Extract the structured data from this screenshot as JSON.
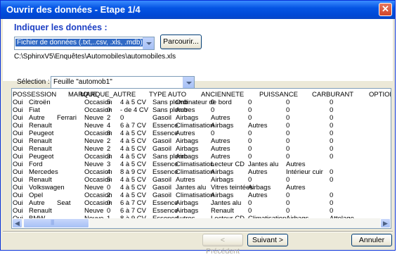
{
  "window": {
    "title": "Ouvrir des données - Etape 1/4",
    "close": "✕"
  },
  "heading": "Indiquer les données :",
  "file_type": {
    "selected": "Fichier de données (.txt,..csv, .xls, .mdb)"
  },
  "browse_label": "Parcourir...",
  "file_path": "C:\\SphinxV5\\Enquêtes\\Automobiles\\automobiles.xls",
  "selection": {
    "label": "Sélection :",
    "value": "Feuille \"automob1\""
  },
  "table": {
    "headers": [
      "POSSESSION",
      "MARQUE",
      "MARQUE_AUTRE",
      "TYPE AUTO",
      "ANCIENNETE",
      "PUISSANCE",
      "CARBURANT",
      "OPTIONS"
    ],
    "rows": [
      [
        "Oui",
        "Citroën",
        "",
        "Occasion",
        "5",
        "4 à 5 CV",
        "Sans plomb",
        "Ordinateur de bord",
        "0",
        "0",
        "0",
        "0"
      ],
      [
        "Oui",
        "Fiat",
        "",
        "Occasion",
        "0",
        "- de 4 CV",
        "Sans plomb",
        "Autres",
        "0",
        "0",
        "0",
        "0"
      ],
      [
        "Oui",
        "Autre",
        "Ferrari",
        "Neuve",
        "2",
        "0",
        "Gasoil",
        "Airbags",
        "Autres",
        "0",
        "0",
        "0"
      ],
      [
        "Oui",
        "Renault",
        "",
        "Neuve",
        "4",
        "6 à 7 CV",
        "Essence",
        "Climatisation",
        "Airbags",
        "Autres",
        "0",
        "0"
      ],
      [
        "Oui",
        "Peugeot",
        "",
        "Occasion",
        "8",
        "4 à 5 CV",
        "Essence",
        "Autres",
        "0",
        "0",
        "0",
        "0"
      ],
      [
        "Oui",
        "Renault",
        "",
        "Neuve",
        "2",
        "4 à 5 CV",
        "Gasoil",
        "Airbags",
        "Autres",
        "0",
        "0",
        "0"
      ],
      [
        "Oui",
        "Renault",
        "",
        "Neuve",
        "2",
        "4 à 5 CV",
        "Gasoil",
        "Airbags",
        "Autres",
        "0",
        "0",
        "0"
      ],
      [
        "Oui",
        "Peugeot",
        "",
        "Occasion",
        "3",
        "4 à 5 CV",
        "Sans plomb",
        "Airbags",
        "Autres",
        "0",
        "0",
        "0"
      ],
      [
        "Oui",
        "Ford",
        "",
        "Neuve",
        "3",
        "4 à 5 CV",
        "Essence",
        "Climatisation",
        "Lecteur CD",
        "Jantes alu",
        "Autres",
        ""
      ],
      [
        "Oui",
        "Mercedes",
        "",
        "Occasion",
        "4",
        "8 à 9 CV",
        "Essence",
        "Climatisation",
        "Airbags",
        "Autres",
        "Intérieur cuir",
        "0"
      ],
      [
        "Oui",
        "Renault",
        "",
        "Occasion",
        "5",
        "4 à 5 CV",
        "Gasoil",
        "Autres",
        "Airbags",
        "0",
        "0",
        "0"
      ],
      [
        "Oui",
        "Volkswagen",
        "",
        "Neuve",
        "0",
        "4 à 5 CV",
        "Gasoil",
        "Jantes alu",
        "Vitres teintées",
        "Airbags",
        "Autres",
        ""
      ],
      [
        "Oui",
        "Opel",
        "",
        "Occasion",
        "2",
        "4 à 5 CV",
        "Gasoil",
        "Climatisation",
        "Airbags",
        "Autres",
        "0",
        "0"
      ],
      [
        "Oui",
        "Autre",
        "Seat",
        "Occasion",
        "0",
        "6 à 7 CV",
        "Essence",
        "Airbags",
        "Jantes alu",
        "0",
        "0",
        "0"
      ],
      [
        "Oui",
        "Renault",
        "",
        "Neuve",
        "0",
        "6 à 7 CV",
        "Essence",
        "Airbags",
        "Renault",
        "0",
        "0",
        "0"
      ],
      [
        "Oui",
        "BMW",
        "",
        "Neuve",
        "1",
        "8 à 9 CV",
        "Essence",
        "Autres",
        "Lecteur CD",
        "Climatisation",
        "Airbags",
        "Attelage"
      ]
    ]
  },
  "buttons": {
    "prev": "< Précédent",
    "next": "Suivant >",
    "cancel": "Annuler"
  },
  "scroll_icons": {
    "left": "◀",
    "right": "▶"
  }
}
